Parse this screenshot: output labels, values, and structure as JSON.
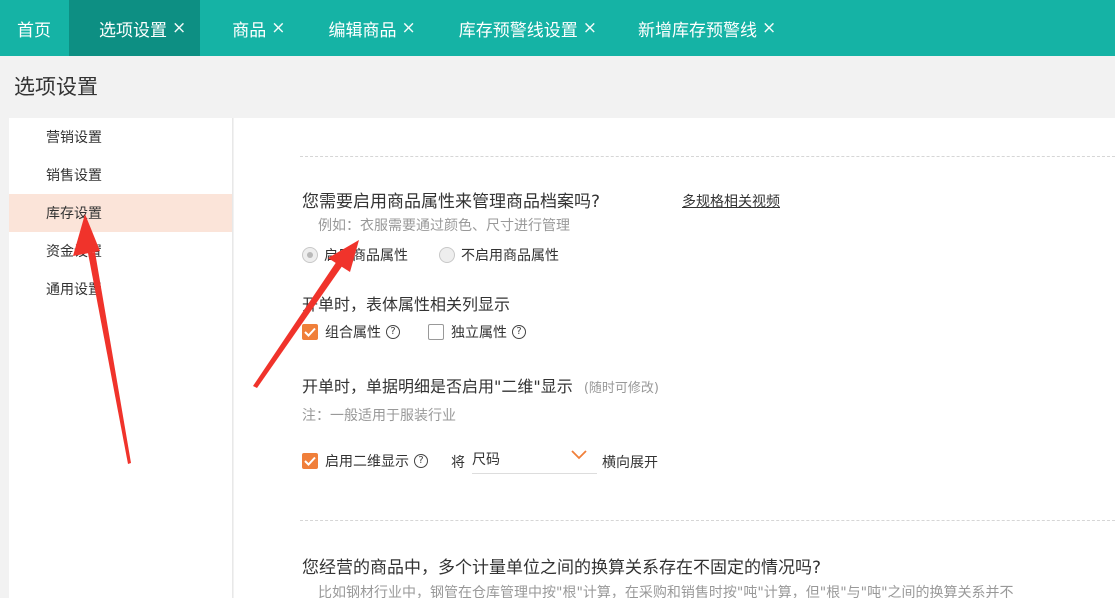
{
  "tabs": [
    {
      "label": "首页",
      "closable": false,
      "active": false
    },
    {
      "label": "选项设置",
      "closable": true,
      "active": true
    },
    {
      "label": "商品",
      "closable": true,
      "active": false
    },
    {
      "label": "编辑商品",
      "closable": true,
      "active": false
    },
    {
      "label": "库存预警线设置",
      "closable": true,
      "active": false
    },
    {
      "label": "新增库存预警线",
      "closable": true,
      "active": false
    }
  ],
  "tab_close_glyph": "×",
  "page_title": "选项设置",
  "sidebar": {
    "items": [
      {
        "label": "营销设置",
        "active": false
      },
      {
        "label": "销售设置",
        "active": false
      },
      {
        "label": "库存设置",
        "active": true
      },
      {
        "label": "资金设置",
        "active": false
      },
      {
        "label": "通用设置",
        "active": false
      }
    ]
  },
  "section_attr": {
    "question": "您需要启用商品属性来管理商品档案吗?",
    "video_link": "多规格相关视频",
    "hint": "例如：衣服需要通过颜色、尺寸进行管理",
    "radio_enable": "启用商品属性",
    "radio_disable": "不启用商品属性",
    "columns_title": "开单时，表体属性相关列显示",
    "check_combined": "组合属性",
    "check_independent": "独立属性",
    "twod_title": "开单时，单据明细是否启用\"二维\"显示",
    "twod_note": "(随时可修改)",
    "twod_hint": "注：一般适用于服装行业",
    "check_twod": "启用二维显示",
    "will_label": "将",
    "select_value": "尺码",
    "expand_label": "横向展开"
  },
  "section_unit": {
    "question": "您经营的商品中，多个计量单位之间的换算关系存在不固定的情况吗?",
    "hint": "比如钢材行业中，钢管在仓库管理中按\"根\"计算，在采购和销售时按\"吨\"计算，但\"根\"与\"吨\"之间的换算关系并不"
  },
  "colors": {
    "tabbar": "#15b3a5",
    "tab_active": "#0d8f83",
    "sidebar_active": "#fbe4d9",
    "checkbox_on": "#f07f3a",
    "annotation_arrow": "#f0332b"
  },
  "icons": {
    "help": "question-circle-icon",
    "dropdown": "chevron-down-icon",
    "check": "check-icon"
  }
}
